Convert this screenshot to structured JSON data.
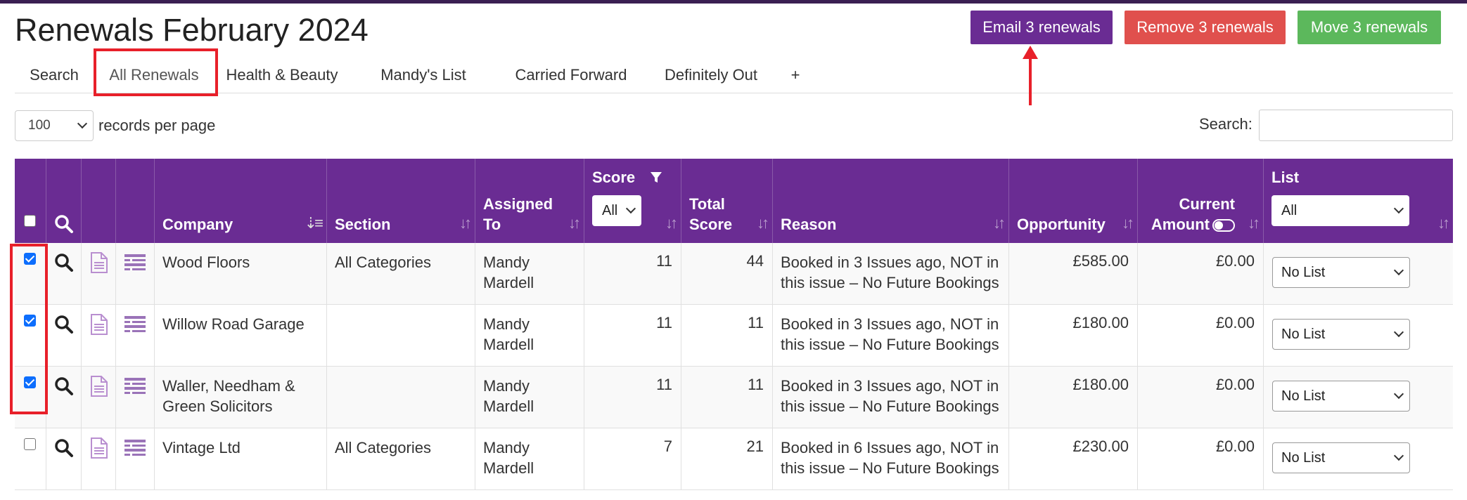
{
  "page": {
    "title": "Renewals February 2024"
  },
  "actions": {
    "email": "Email 3 renewals",
    "remove": "Remove 3 renewals",
    "move": "Move 3 renewals"
  },
  "tabs": [
    "Search",
    "All Renewals",
    "Health & Beauty",
    "Mandy's List",
    "Carried Forward",
    "Definitely Out",
    "+"
  ],
  "active_tab": "All Renewals",
  "records": {
    "per_page_value": "100",
    "label": "records per page"
  },
  "search": {
    "label": "Search:",
    "value": ""
  },
  "table": {
    "headers": {
      "company": "Company",
      "section": "Section",
      "assigned": [
        "Assigned",
        "To"
      ],
      "score": "Score",
      "score_filter": "All",
      "total_score": [
        "Total",
        "Score"
      ],
      "reason": "Reason",
      "opportunity": "Opportunity",
      "current_amount": [
        "Current",
        "Amount"
      ],
      "list": "List",
      "list_filter": "All"
    },
    "rows": [
      {
        "checked": true,
        "company": [
          "Wood Floors",
          ""
        ],
        "section": "All Categories",
        "assigned": [
          "Mandy",
          "Mardell"
        ],
        "score": "11",
        "total_score": "44",
        "reason": [
          "Booked in 3 Issues ago, NOT in",
          "this issue – No Future Bookings"
        ],
        "opportunity": "£585.00",
        "current_amount": "£0.00",
        "list": "No List"
      },
      {
        "checked": true,
        "company": [
          "Willow Road Garage",
          ""
        ],
        "section": "",
        "assigned": [
          "Mandy",
          "Mardell"
        ],
        "score": "11",
        "total_score": "11",
        "reason": [
          "Booked in 3 Issues ago, NOT in",
          "this issue – No Future Bookings"
        ],
        "opportunity": "£180.00",
        "current_amount": "£0.00",
        "list": "No List"
      },
      {
        "checked": true,
        "company": [
          "Waller, Needham &",
          "Green Solicitors"
        ],
        "section": "",
        "assigned": [
          "Mandy",
          "Mardell"
        ],
        "score": "11",
        "total_score": "11",
        "reason": [
          "Booked in 3 Issues ago, NOT in",
          "this issue – No Future Bookings"
        ],
        "opportunity": "£180.00",
        "current_amount": "£0.00",
        "list": "No List"
      },
      {
        "checked": false,
        "company": [
          "Vintage Ltd",
          ""
        ],
        "section": "All Categories",
        "assigned": [
          "Mandy",
          "Mardell"
        ],
        "score": "7",
        "total_score": "21",
        "reason": [
          "Booked in 6 Issues ago, NOT in",
          "this issue – No Future Bookings"
        ],
        "opportunity": "£230.00",
        "current_amount": "£0.00",
        "list": "No List"
      }
    ]
  },
  "colors": {
    "brand_purple": "#6a2c93",
    "remove_red": "#e0504d",
    "move_green": "#5cb85c",
    "annotation_red": "#e8202a",
    "checkbox_blue": "#0d6efd"
  }
}
